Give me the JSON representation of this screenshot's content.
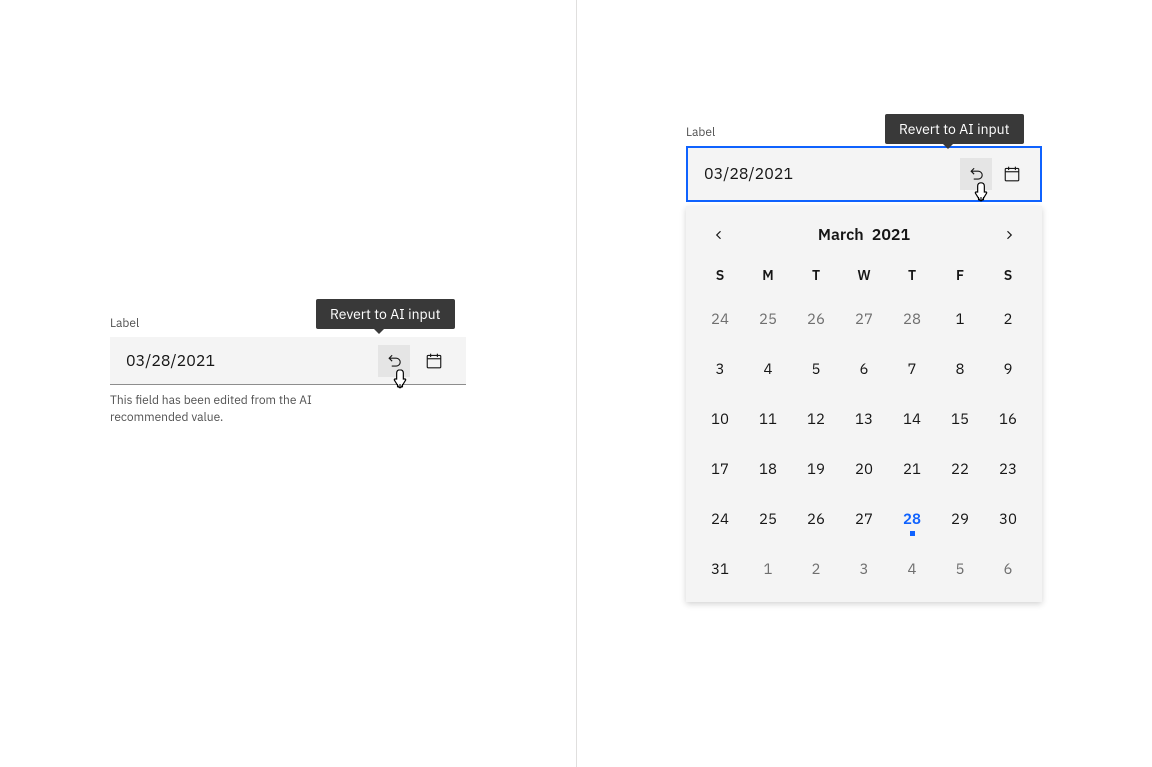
{
  "left": {
    "label": "Label",
    "value": "03/28/2021",
    "helper": "This field has been edited from the AI recommended value.",
    "tooltip": "Revert to AI input"
  },
  "right": {
    "label": "Label",
    "value": "03/28/2021",
    "tooltip": "Revert to AI input"
  },
  "calendar": {
    "month": "March",
    "year": "2021",
    "dow": [
      "S",
      "M",
      "T",
      "W",
      "T",
      "F",
      "S"
    ],
    "weeks": [
      [
        {
          "d": "24",
          "muted": true
        },
        {
          "d": "25",
          "muted": true
        },
        {
          "d": "26",
          "muted": true
        },
        {
          "d": "27",
          "muted": true
        },
        {
          "d": "28",
          "muted": true
        },
        {
          "d": "1"
        },
        {
          "d": "2"
        }
      ],
      [
        {
          "d": "3"
        },
        {
          "d": "4"
        },
        {
          "d": "5"
        },
        {
          "d": "6"
        },
        {
          "d": "7"
        },
        {
          "d": "8"
        },
        {
          "d": "9"
        }
      ],
      [
        {
          "d": "10"
        },
        {
          "d": "11"
        },
        {
          "d": "12"
        },
        {
          "d": "13"
        },
        {
          "d": "14"
        },
        {
          "d": "15"
        },
        {
          "d": "16"
        }
      ],
      [
        {
          "d": "17"
        },
        {
          "d": "18"
        },
        {
          "d": "19"
        },
        {
          "d": "20"
        },
        {
          "d": "21"
        },
        {
          "d": "22"
        },
        {
          "d": "23"
        }
      ],
      [
        {
          "d": "24"
        },
        {
          "d": "25"
        },
        {
          "d": "26"
        },
        {
          "d": "27"
        },
        {
          "d": "28",
          "selected": true
        },
        {
          "d": "29"
        },
        {
          "d": "30"
        }
      ],
      [
        {
          "d": "31"
        },
        {
          "d": "1",
          "muted": true
        },
        {
          "d": "2",
          "muted": true
        },
        {
          "d": "3",
          "muted": true
        },
        {
          "d": "4",
          "muted": true
        },
        {
          "d": "5",
          "muted": true
        },
        {
          "d": "6",
          "muted": true
        }
      ]
    ]
  }
}
